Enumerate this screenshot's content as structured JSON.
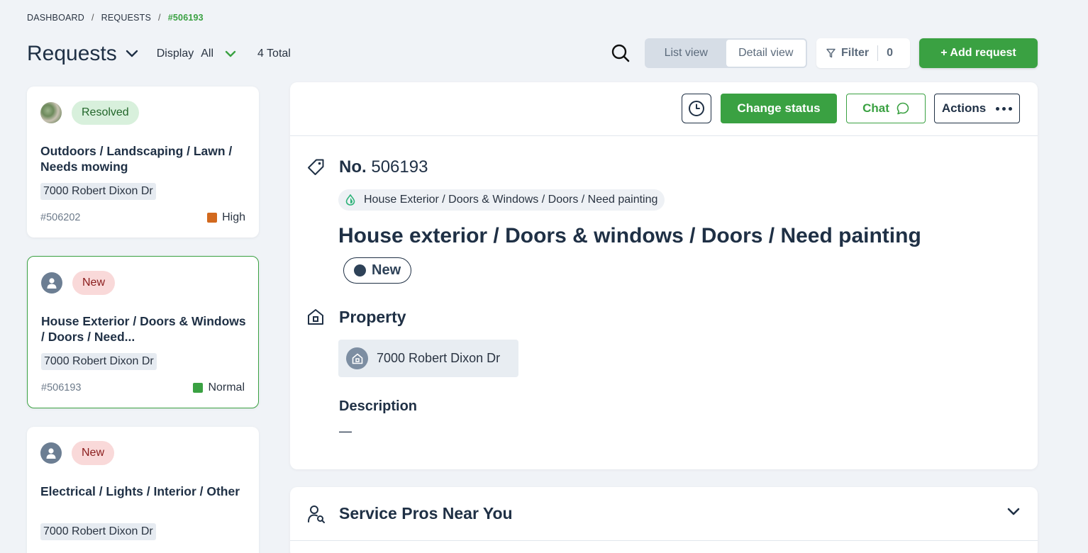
{
  "breadcrumb": {
    "items": [
      "DASHBOARD",
      "REQUESTS"
    ],
    "separator": "/",
    "current": "#506193"
  },
  "header": {
    "title": "Requests",
    "display_label": "Display",
    "display_value": "All",
    "total": "4 Total",
    "view_toggle": {
      "list": "List view",
      "detail": "Detail view",
      "active": "detail"
    },
    "filter_label": "Filter",
    "filter_count": "0",
    "add_button": "+ Add request"
  },
  "cards": [
    {
      "status": "Resolved",
      "status_type": "resolved",
      "avatar": "photo",
      "title": "Outdoors / Landscaping / Lawn / Needs mowing",
      "address": "7000 Robert Dixon Dr",
      "id": "#506202",
      "priority": "High",
      "priority_color": "#d2691e",
      "selected": false
    },
    {
      "status": "New",
      "status_type": "new",
      "avatar": "person",
      "title": "House Exterior / Doors & Windows / Doors / Need...",
      "address": "7000 Robert Dixon Dr",
      "id": "#506193",
      "priority": "Normal",
      "priority_color": "#3aa142",
      "selected": true
    },
    {
      "status": "New",
      "status_type": "new",
      "avatar": "person",
      "title": "Electrical / Lights / Interior / Other",
      "address": "7000 Robert Dixon Dr",
      "id": "",
      "priority": "",
      "priority_color": "",
      "selected": false
    }
  ],
  "detail": {
    "toolbar": {
      "change_status": "Change status",
      "chat": "Chat",
      "actions": "Actions"
    },
    "number_label": "No.",
    "number_value": "506193",
    "category": "House Exterior / Doors & Windows / Doors / Need painting",
    "title": "House exterior / Doors & windows / Doors / Need painting",
    "status": "New",
    "property_label": "Property",
    "property_address": "7000 Robert Dixon Dr",
    "description_label": "Description",
    "description_value": "—"
  },
  "service_pros": {
    "label": "Service Pros Near You"
  },
  "colors": {
    "accent": "#3aa142",
    "text_dark": "#1f3045",
    "background": "#f0f3f7"
  },
  "icons": [
    "search-icon",
    "chevron-down-icon",
    "filter-icon",
    "history-icon",
    "chat-bubble-icon",
    "more-dots-icon",
    "tag-icon",
    "drop-icon",
    "house-icon",
    "person-search-icon"
  ]
}
